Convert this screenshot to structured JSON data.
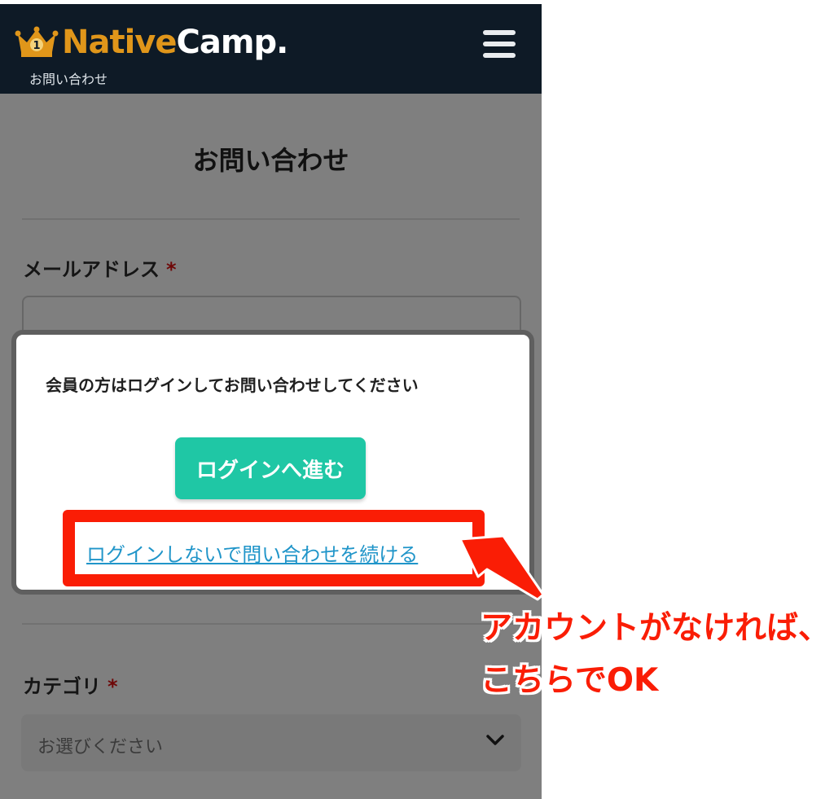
{
  "header": {
    "logo_native": "Native",
    "logo_camp": "Camp.",
    "subtitle": "お問い合わせ",
    "menu_icon": "hamburger-icon",
    "crown_icon": "crown-icon"
  },
  "form": {
    "title": "お問い合わせ",
    "email_label": "メールアドレス",
    "required_mark": "*",
    "category_label": "カテゴリ",
    "category_placeholder": "お選びください"
  },
  "modal": {
    "message": "会員の方はログインしてお問い合わせしてください",
    "login_button": "ログインへ進む",
    "continue_link": "ログインしないで問い合わせを続ける"
  },
  "annotation": {
    "line1": "アカウントがなければ、",
    "line2": "こちらでOK",
    "color": "#fa1d05"
  },
  "colors": {
    "header_bg": "#0e1a26",
    "logo_orange": "#e0961a",
    "button_green": "#1fc7a5",
    "link_blue": "#2095c9"
  }
}
